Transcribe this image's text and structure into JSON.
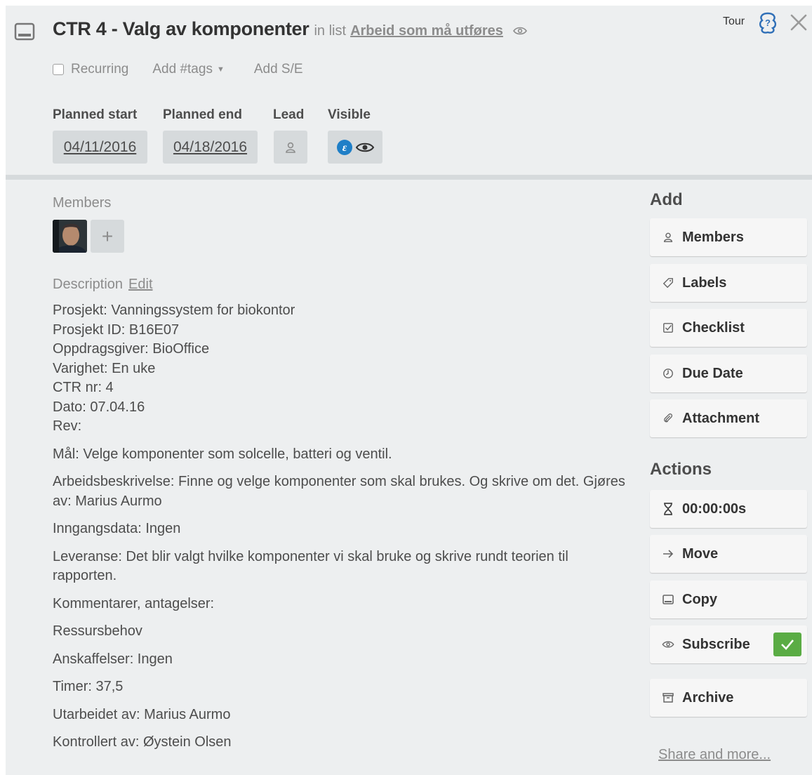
{
  "card": {
    "title": "CTR 4 - Valg av komponenter",
    "in_list_prefix": "in list",
    "list_name": "Arbeid som må utføres",
    "tour_label": "Tour"
  },
  "meta": {
    "recurring_label": "Recurring",
    "tags_label": "Add #tags",
    "add_se_label": "Add S/E"
  },
  "fields": {
    "planned_start_label": "Planned start",
    "planned_start_value": "04/11/2016",
    "planned_end_label": "Planned end",
    "planned_end_value": "04/18/2016",
    "lead_label": "Lead",
    "visible_label": "Visible"
  },
  "members": {
    "label": "Members",
    "add_symbol": "+"
  },
  "description": {
    "label": "Description",
    "edit_label": "Edit",
    "lines": [
      "Prosjekt: Vanningssystem for biokontor",
      "Prosjekt ID: B16E07",
      "Oppdragsgiver: BioOffice",
      "Varighet: En uke",
      "CTR nr: 4",
      "Dato: 07.04.16",
      "Rev:"
    ],
    "paragraphs": [
      "Mål: Velge komponenter som solcelle, batteri og ventil.",
      "Arbeidsbeskrivelse: Finne og velge komponenter som skal brukes. Og skrive om det. Gjøres av: Marius Aurmo",
      "Inngangsdata: Ingen",
      "Leveranse: Det blir valgt hvilke komponenter vi skal bruke og skrive rundt teorien til rapporten.",
      "Kommentarer, antagelser:",
      "Ressursbehov",
      "Anskaffelser: Ingen",
      "Timer: 37,5",
      "Utarbeidet av: Marius Aurmo",
      "Kontrollert av: Øystein Olsen"
    ]
  },
  "sidebar": {
    "add_title": "Add",
    "add_buttons": [
      {
        "label": "Members",
        "icon": "person-icon"
      },
      {
        "label": "Labels",
        "icon": "tag-icon"
      },
      {
        "label": "Checklist",
        "icon": "checklist-icon"
      },
      {
        "label": "Due Date",
        "icon": "clock-icon"
      },
      {
        "label": "Attachment",
        "icon": "paperclip-icon"
      }
    ],
    "actions_title": "Actions",
    "action_buttons": [
      {
        "label": "00:00:00s",
        "icon": "hourglass-icon"
      },
      {
        "label": "Move",
        "icon": "arrow-right-icon"
      },
      {
        "label": "Copy",
        "icon": "card-icon"
      },
      {
        "label": "Subscribe",
        "icon": "eye-icon",
        "checked": true
      },
      {
        "label": "Archive",
        "icon": "archive-icon"
      }
    ],
    "share_label": "Share and more..."
  },
  "colors": {
    "background": "#edeff0",
    "button_gray": "#d6dadc",
    "subscribe_check": "#5aac44",
    "tour_icon": "#2f6fb7",
    "visibility_badge": "#1f7fc7"
  }
}
